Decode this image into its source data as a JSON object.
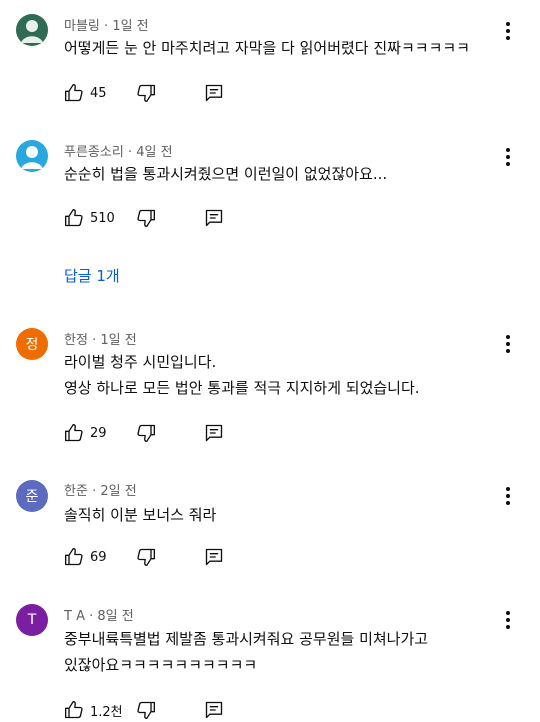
{
  "comments": [
    {
      "author": "마블링",
      "time": "1일 전",
      "text_lines": [
        "어떻게든 눈 안 마주치려고 자막을 다 읽어버렸다 진짜ㅋㅋㅋㅋㅋ"
      ],
      "likes": "45",
      "avatar": {
        "type": "image",
        "color": "#2f6b55",
        "letter": ""
      }
    },
    {
      "author": "푸른종소리",
      "time": "4일 전",
      "text_lines": [
        "순순히 법을 통과시켜줬으면 이런일이 없었잖아요..."
      ],
      "likes": "510",
      "avatar": {
        "type": "default",
        "color": "#29a8e0",
        "letter": ""
      }
    },
    {
      "author": "한정",
      "time": "1일 전",
      "text_lines": [
        "라이벌 청주 시민입니다.",
        "영상 하나로 모든 법안 통과를 적극 지지하게 되었습니다."
      ],
      "likes": "29",
      "avatar": {
        "type": "letter",
        "color": "#ef6c00",
        "letter": "정"
      }
    },
    {
      "author": "한준",
      "time": "2일 전",
      "text_lines": [
        "솔직히 이분 보너스 줘라"
      ],
      "likes": "69",
      "avatar": {
        "type": "letter",
        "color": "#5c6bc0",
        "letter": "준"
      }
    },
    {
      "author": "T A",
      "time": "8일 전",
      "text_lines": [
        "중부내륙특별법 제발좀 통과시켜줘요 공무원들 미쳐나가고",
        "있잖아요ㅋㅋㅋㅋㅋㅋㅋㅋㅋㅋ"
      ],
      "likes": "1.2천",
      "avatar": {
        "type": "letter",
        "color": "#7b1fa2",
        "letter": "T"
      }
    }
  ],
  "replies_link": "답글 1개",
  "separator": "·",
  "icons": {
    "like": "thumb-up-icon",
    "dislike": "thumb-down-icon",
    "reply": "reply-comment-icon",
    "more": "more-vert-icon"
  },
  "colors": {
    "link": "#065fd4",
    "meta": "#606060",
    "text": "#0f0f0f"
  }
}
